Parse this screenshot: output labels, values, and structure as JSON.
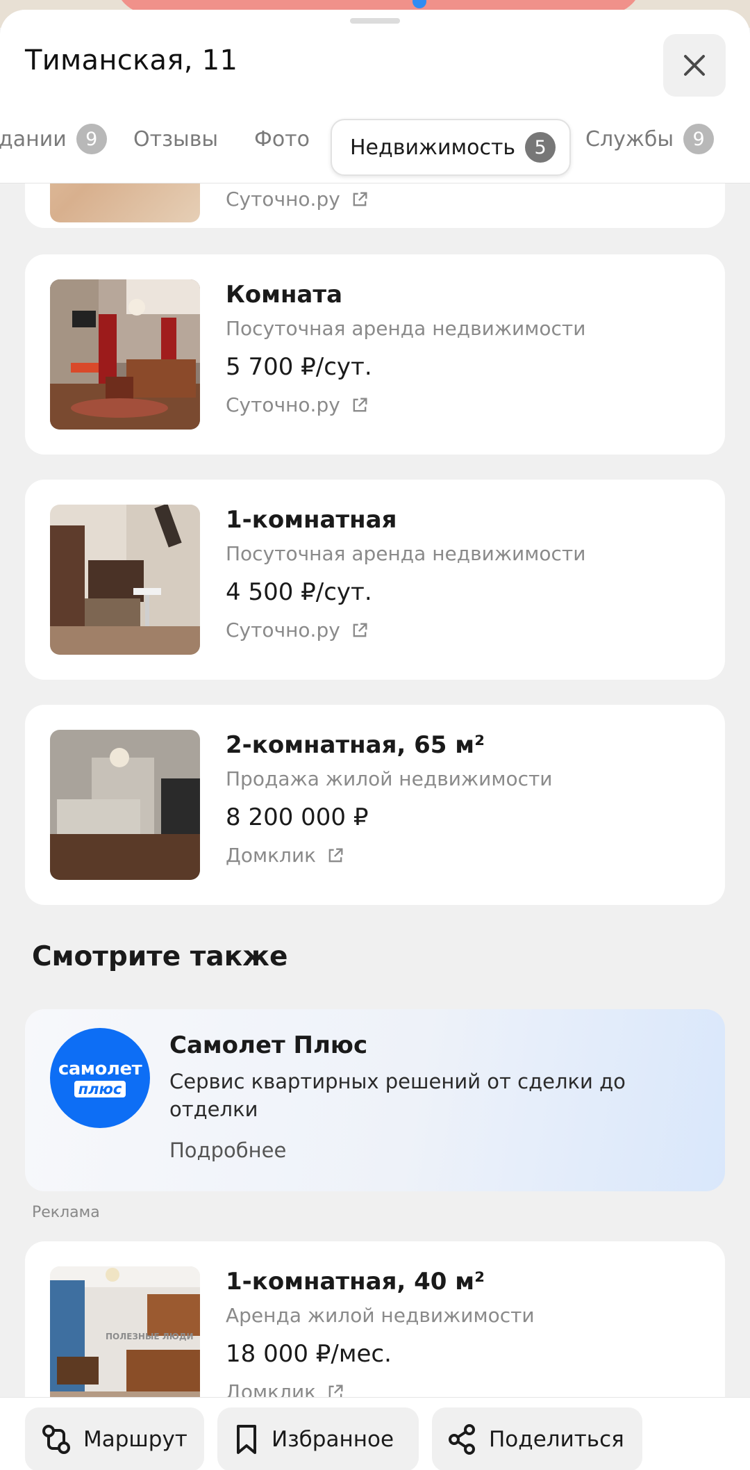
{
  "header": {
    "title": "Тиманская, 11"
  },
  "tabs": [
    {
      "label": "дании",
      "badge": "9"
    },
    {
      "label": "Отзывы",
      "badge": ""
    },
    {
      "label": "Фото",
      "badge": ""
    },
    {
      "label": "Недвижимость",
      "badge": "5",
      "active": true
    },
    {
      "label": "Службы",
      "badge": "9"
    }
  ],
  "partial_listing": {
    "source": "Суточно.ру"
  },
  "listings": [
    {
      "title": "Комната",
      "subtitle": "Посуточная аренда недвижимости",
      "price": "5 700 ₽/сут.",
      "source": "Суточно.ру"
    },
    {
      "title": "1-комнатная",
      "subtitle": "Посуточная аренда недвижимости",
      "price": "4 500 ₽/сут.",
      "source": "Суточно.ру"
    },
    {
      "title": "2-комнатная, 65 м²",
      "subtitle": "Продажа жилой недвижимости",
      "price": "8 200 000 ₽",
      "source": "Домклик"
    }
  ],
  "see_also": {
    "title": "Смотрите также"
  },
  "ad": {
    "logo_line1": "самолет",
    "logo_line2": "плюс",
    "title": "Самолет Плюс",
    "description": "Сервис квартирных решений от сделки до отделки",
    "more": "Подробнее",
    "label": "Реклама"
  },
  "bottom_listing": {
    "title": "1-комнатная, 40 м²",
    "subtitle": "Аренда жилой недвижимости",
    "price": "18 000 ₽/мес.",
    "source": "Домклик",
    "watermark": "ПОЛЕЗНЫЕ ЛЮДИ"
  },
  "bottom_bar": {
    "route": "Маршрут",
    "favorite": "Избранное",
    "share": "Поделиться"
  },
  "colors": {
    "accent_logo": "#0d6ef5",
    "route_road": "#f0918a",
    "map_pin": "#2f8cf3"
  }
}
